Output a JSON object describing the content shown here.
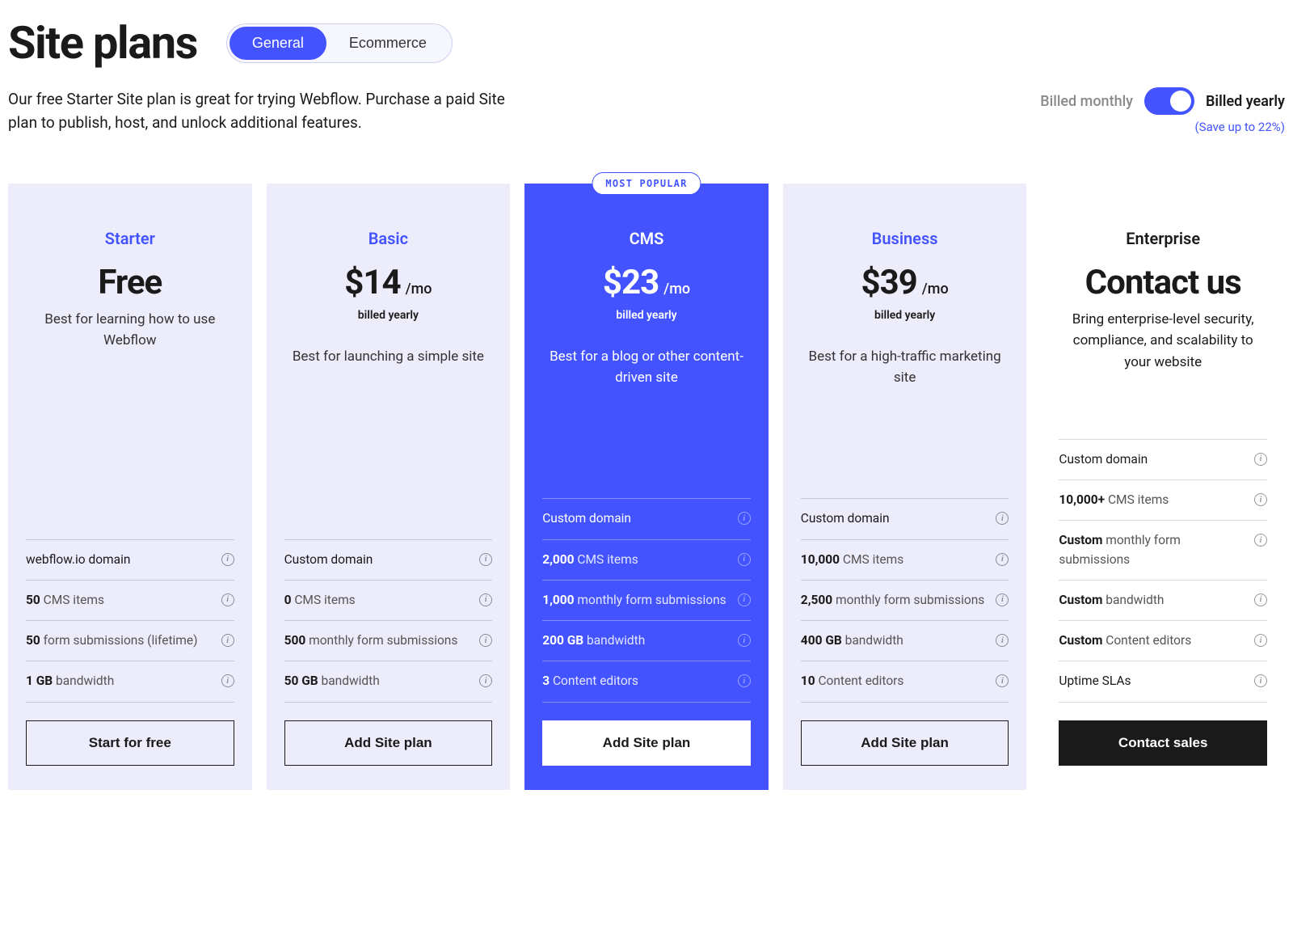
{
  "page_title": "Site plans",
  "tabs": {
    "general": "General",
    "ecommerce": "Ecommerce"
  },
  "description": "Our free Starter Site plan is great for trying Webflow. Purchase a paid Site plan to publish, host, and unlock additional features.",
  "billing": {
    "monthly_label": "Billed monthly",
    "yearly_label": "Billed yearly",
    "save_note": "(Save up to 22%)"
  },
  "popular_badge": "MOST POPULAR",
  "plans": [
    {
      "id": "starter",
      "name": "Starter",
      "price": "Free",
      "price_suffix": "",
      "billed_note": "",
      "desc": "Best for learning how to use Webflow",
      "features": [
        {
          "bold": "",
          "rest": "webflow.io domain"
        },
        {
          "bold": "50",
          "rest": " CMS items"
        },
        {
          "bold": "50",
          "rest": " form submissions (lifetime)"
        },
        {
          "bold": "1 GB",
          "rest": " bandwidth"
        }
      ],
      "cta": "Start for free"
    },
    {
      "id": "basic",
      "name": "Basic",
      "price": "$14",
      "price_suffix": "/mo",
      "billed_note": "billed yearly",
      "desc": "Best for launching a simple site",
      "features": [
        {
          "bold": "",
          "rest": "Custom domain"
        },
        {
          "bold": "0",
          "rest": " CMS items"
        },
        {
          "bold": "500",
          "rest": " monthly form submissions"
        },
        {
          "bold": "50 GB",
          "rest": " bandwidth"
        }
      ],
      "cta": "Add Site plan"
    },
    {
      "id": "cms",
      "name": "CMS",
      "price": "$23",
      "price_suffix": "/mo",
      "billed_note": "billed yearly",
      "desc": "Best for a blog or other content-driven site",
      "features": [
        {
          "bold": "",
          "rest": "Custom domain"
        },
        {
          "bold": "2,000",
          "rest": " CMS items"
        },
        {
          "bold": "1,000",
          "rest": " monthly form submissions"
        },
        {
          "bold": "200 GB",
          "rest": " bandwidth"
        },
        {
          "bold": "3",
          "rest": " Content editors"
        }
      ],
      "cta": "Add Site plan"
    },
    {
      "id": "business",
      "name": "Business",
      "price": "$39",
      "price_suffix": "/mo",
      "billed_note": "billed yearly",
      "desc": "Best for a high-traffic marketing site",
      "features": [
        {
          "bold": "",
          "rest": "Custom domain"
        },
        {
          "bold": "10,000",
          "rest": " CMS items"
        },
        {
          "bold": "2,500",
          "rest": " monthly form submissions"
        },
        {
          "bold": "400 GB",
          "rest": " bandwidth"
        },
        {
          "bold": "10",
          "rest": " Content editors"
        }
      ],
      "cta": "Add Site plan"
    },
    {
      "id": "enterprise",
      "name": "Enterprise",
      "price": "Contact us",
      "price_suffix": "",
      "billed_note": "",
      "desc": "Bring enterprise-level security, compliance, and scalability to your website",
      "features": [
        {
          "bold": "",
          "rest": "Custom domain"
        },
        {
          "bold": "10,000+",
          "rest": " CMS items"
        },
        {
          "bold": "Custom",
          "rest": " monthly form submissions"
        },
        {
          "bold": "Custom",
          "rest": " bandwidth"
        },
        {
          "bold": "Custom",
          "rest": " Content editors"
        },
        {
          "bold": "",
          "rest": "Uptime SLAs"
        }
      ],
      "cta": "Contact sales"
    }
  ]
}
